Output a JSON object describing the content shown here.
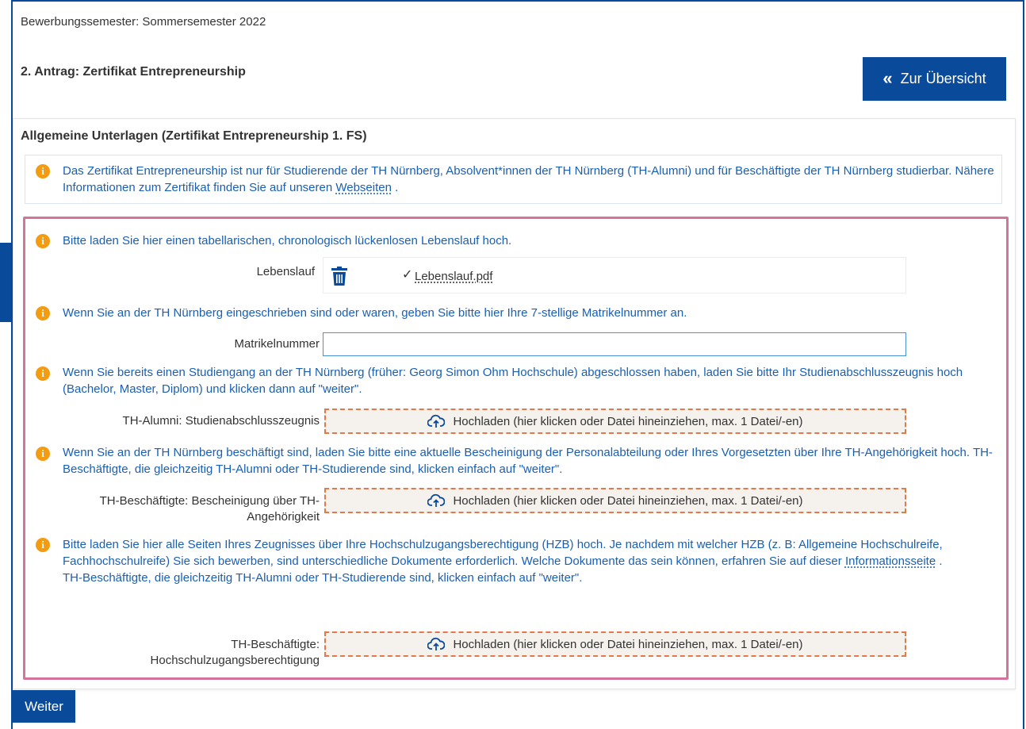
{
  "header": {
    "semester": "Bewerbungssemester: Sommersemester 2022",
    "antrag": "2. Antrag: Zertifikat Entrepreneurship",
    "overview_button": "Zur Übersicht"
  },
  "panel": {
    "title": "Allgemeine Unterlagen (Zertifikat Entrepreneurship 1. FS)",
    "info_text_a": "Das Zertifikat Entrepreneurship ist nur für Studierende der TH Nürnberg, Absolvent*innen der TH Nürnberg (TH-Alumni) und für Beschäftigte der TH Nürnberg studierbar. Nähere Informationen zum Zertifikat finden Sie auf unseren ",
    "info_link": "Webseiten",
    "info_text_b": " ."
  },
  "sections": {
    "cv": {
      "hint": "Bitte laden Sie hier einen tabellarischen, chronologisch lückenlosen Lebenslauf hoch.",
      "label": "Lebenslauf",
      "file_name": "Lebenslauf.pdf"
    },
    "matrikel": {
      "hint": "Wenn Sie an der TH Nürnberg eingeschrieben sind oder waren, geben Sie bitte hier Ihre 7-stellige Matrikelnummer an.",
      "label": "Matrikelnummer",
      "value": ""
    },
    "alumni": {
      "hint": "Wenn Sie bereits einen Studiengang an der TH Nürnberg (früher: Georg Simon Ohm Hochschule) abgeschlossen haben, laden Sie bitte Ihr Studienabschlusszeugnis hoch (Bachelor, Master, Diplom) und klicken dann auf \"weiter\".",
      "label": "TH-Alumni: Studienabschlusszeugnis",
      "upload_text": "Hochladen (hier klicken oder Datei hineinziehen, max. 1 Datei/-en)"
    },
    "employee": {
      "hint": "Wenn Sie an der TH Nürnberg beschäftigt sind, laden Sie bitte eine aktuelle Bescheinigung der Personalabteilung oder Ihres Vorgesetzten über Ihre TH-Angehörigkeit hoch. TH-Beschäftigte, die gleichzeitig TH-Alumni oder TH-Studierende sind, klicken einfach auf \"weiter\".",
      "label": "TH-Beschäftigte: Bescheinigung über TH-Angehörigkeit",
      "upload_text": "Hochladen (hier klicken oder Datei hineinziehen, max. 1 Datei/-en)"
    },
    "hzb": {
      "hint_a": "Bitte laden Sie hier alle Seiten Ihres Zeugnisses über Ihre Hochschulzugangsberechtigung (HZB) hoch. Je nachdem mit welcher HZB (z. B: Allgemeine Hochschulreife, Fachhochschulreife) Sie sich bewerben, sind unterschiedliche Dokumente erforderlich. Welche Dokumente das sein können, erfahren Sie auf dieser ",
      "hint_link": "Informationsseite",
      "hint_b": " .",
      "hint_c": "TH-Beschäftigte, die gleichzeitig TH-Alumni oder TH-Studierende sind, klicken einfach auf \"weiter\".",
      "label": "TH-Beschäftigte: Hochschulzugangsberechtigung",
      "upload_text": "Hochladen (hier klicken oder Datei hineinziehen, max. 1 Datei/-en)"
    }
  },
  "footer": {
    "next_button": "Weiter"
  }
}
